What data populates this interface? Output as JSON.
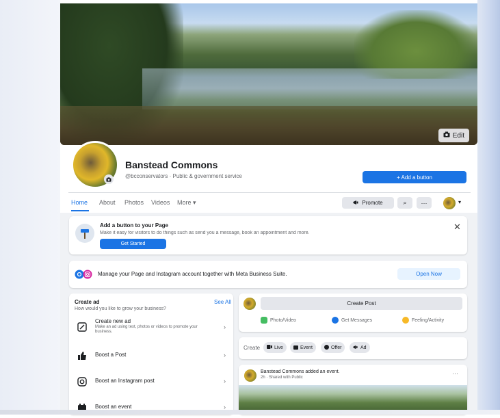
{
  "cover": {
    "edit_label": "Edit"
  },
  "profile": {
    "name": "Banstead Commons",
    "subtitle": "@bcconservators · Public & government service",
    "add_button_label": "+ Add a button"
  },
  "nav": {
    "tabs": [
      "Home",
      "About",
      "Photos",
      "Videos",
      "More ▾"
    ],
    "promote_label": "Promote",
    "search_glyph": "⌕",
    "more_glyph": "···",
    "caret_glyph": "▾"
  },
  "add_button_card": {
    "title": "Add a button to your Page",
    "description": "Make it easy for visitors to do things such as send you a message, book an appointment and more.",
    "cta": "Get Started",
    "close_glyph": "✕"
  },
  "meta_card": {
    "text": "Manage your Page and Instagram account together with Meta Business Suite.",
    "cta": "Open Now"
  },
  "create_ad": {
    "title": "Create ad",
    "subtitle": "How would you like to grow your business?",
    "see_all": "See All",
    "items": [
      {
        "label": "Create new ad",
        "desc": "Make an ad using text, photos or videos to promote your business.",
        "icon": "edit-icon"
      },
      {
        "label": "Boost a Post",
        "desc": "",
        "icon": "thumbs-up-icon"
      },
      {
        "label": "Boost an Instagram post",
        "desc": "",
        "icon": "instagram-icon"
      },
      {
        "label": "Boost an event",
        "desc": "",
        "icon": "event-icon"
      }
    ],
    "chevron": "›"
  },
  "create_post": {
    "button": "Create Post",
    "actions": [
      {
        "label": "Photo/Video",
        "color": "#45bd62"
      },
      {
        "label": "Get Messages",
        "color": "#1b74e4"
      },
      {
        "label": "Feeling/Activity",
        "color": "#f7b928"
      }
    ]
  },
  "create_bar": {
    "label": "Create",
    "chips": [
      "Live",
      "Event",
      "Offer",
      "Ad"
    ]
  },
  "event_post": {
    "title": "Banstead Commons added an event.",
    "time": "2h · Shared with Public",
    "more": "···"
  },
  "colors": {
    "accent": "#1b74e4",
    "surface": "#f0f2f5",
    "button_gray": "#e4e6eb"
  }
}
